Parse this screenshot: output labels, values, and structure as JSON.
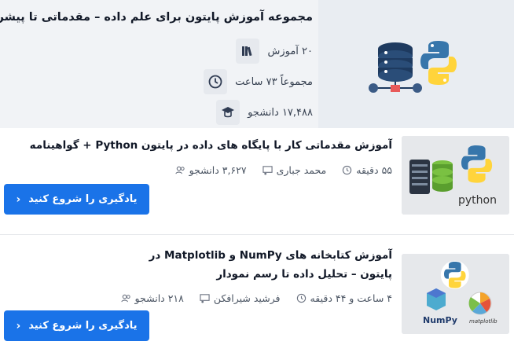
{
  "bundle": {
    "title": "مجموعه آموزش پایتون برای علم داده – مقدماتی تا پیشرفته",
    "courses": "۲۰ آموزش",
    "duration": "مجموعاً ۷۳ ساعت",
    "students": "۱۷,۴۸۸ دانشجو",
    "icons": [
      "books-icon",
      "clock-icon",
      "graduate-icon"
    ]
  },
  "courses": [
    {
      "title": "آموزش مقدماتی کار با پایگاه های داده در پایتون Python + گواهینامه",
      "students": "۳,۶۲۷ دانشجو",
      "instructor": "محمد جباری",
      "duration": "۵۵ دقیقه",
      "button": "یادگیری را شروع کنید",
      "thumb_label": "python"
    },
    {
      "title": "آموزش کتابخانه های NumPy و Matplotlib در پایتون – تحلیل داده تا رسم نمودار",
      "students": "۲۱۸ دانشجو",
      "instructor": "فرشید شیرافکن",
      "duration": "۴ ساعت و ۴۴ دقیقه",
      "button": "یادگیری را شروع کنید",
      "thumb_label": "NumPy",
      "thumb_label2": "matplotlib"
    }
  ],
  "colors": {
    "accent": "#1a73e8",
    "python_blue": "#3776ab",
    "python_yellow": "#ffd43b"
  }
}
